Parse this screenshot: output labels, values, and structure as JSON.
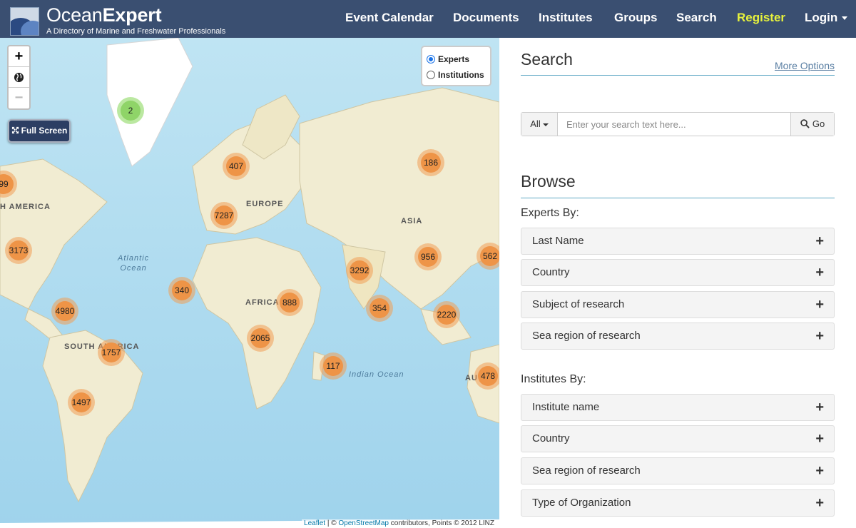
{
  "brand": {
    "light": "Ocean",
    "bold": "Expert",
    "tagline": "A Directory of Marine and Freshwater Professionals"
  },
  "nav": {
    "event_calendar": "Event Calendar",
    "documents": "Documents",
    "institutes": "Institutes",
    "groups": "Groups",
    "search": "Search",
    "register": "Register",
    "login": "Login"
  },
  "map": {
    "zoom_in": "+",
    "zoom_out": "−",
    "fullscreen_label": "Full Screen",
    "layer_experts": "Experts",
    "layer_institutions": "Institutions",
    "layer_selected": "Experts",
    "labels": {
      "north_america": "H AMERICA",
      "europe": "EUROPE",
      "asia": "ASIA",
      "africa": "AFRICA",
      "south_america": "SOUTH AMERICA",
      "australia": "AU",
      "atlantic_1": "Atlantic",
      "atlantic_2": "Ocean",
      "indian": "Indian Ocean"
    },
    "clusters": {
      "c2": "2",
      "c407": "407",
      "c186": "186",
      "c99": "99",
      "c7287": "7287",
      "c3173": "3173",
      "c956": "956",
      "c562": "562",
      "c3292": "3292",
      "c340": "340",
      "c888": "888",
      "c354": "354",
      "c2220": "2220",
      "c4980": "4980",
      "c2065": "2065",
      "c1757": "1757",
      "c117": "117",
      "c478": "478",
      "c1497": "1497"
    },
    "attribution": {
      "leaflet": "Leaflet",
      "sep": " | © ",
      "osm": "OpenStreetMap",
      "rest": " contributors, Points © 2012 LINZ"
    }
  },
  "search": {
    "title": "Search",
    "more_options": "More Options",
    "scope": "All",
    "placeholder": "Enter your search text here...",
    "go": "Go"
  },
  "browse": {
    "title": "Browse",
    "experts_by": "Experts By:",
    "experts_items": [
      "Last Name",
      "Country",
      "Subject of research",
      "Sea region of research"
    ],
    "institutes_by": "Institutes By:",
    "institutes_items": [
      "Institute name",
      "Country",
      "Sea region of research",
      "Type of Organization"
    ]
  },
  "colors": {
    "navbar": "#3a4f71",
    "register": "#e7f23c",
    "cluster": "#ee9447",
    "cluster_green": "#8fd468",
    "ocean": "#aedcf0",
    "land": "#f1ecd2"
  },
  "icons": {
    "expand": "+",
    "fullscreen": "arrows-expand-icon",
    "search": "magnifier-icon",
    "globe": "globe-icon"
  }
}
